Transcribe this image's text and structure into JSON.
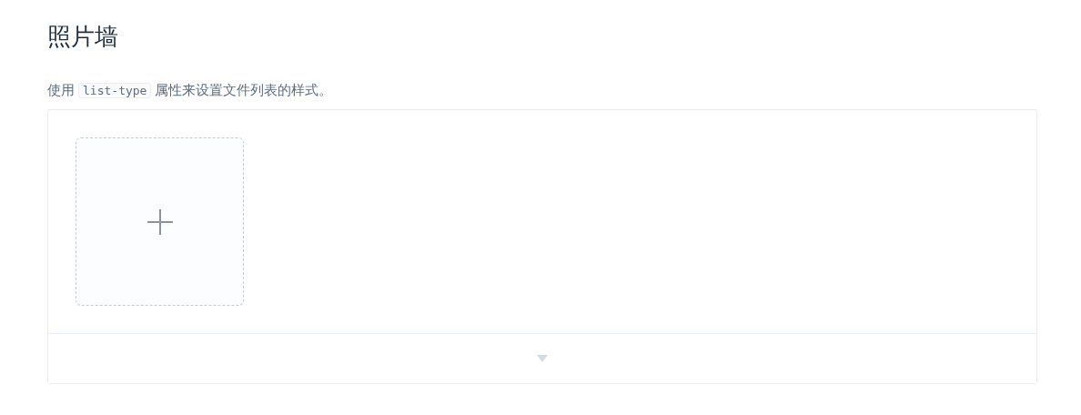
{
  "title": "照片墙",
  "description": {
    "before": "使用",
    "code": "list-type",
    "after": "属性来设置文件列表的样式。"
  },
  "demo": {
    "upload_trigger": {
      "kind": "plus"
    },
    "expanded": false
  }
}
